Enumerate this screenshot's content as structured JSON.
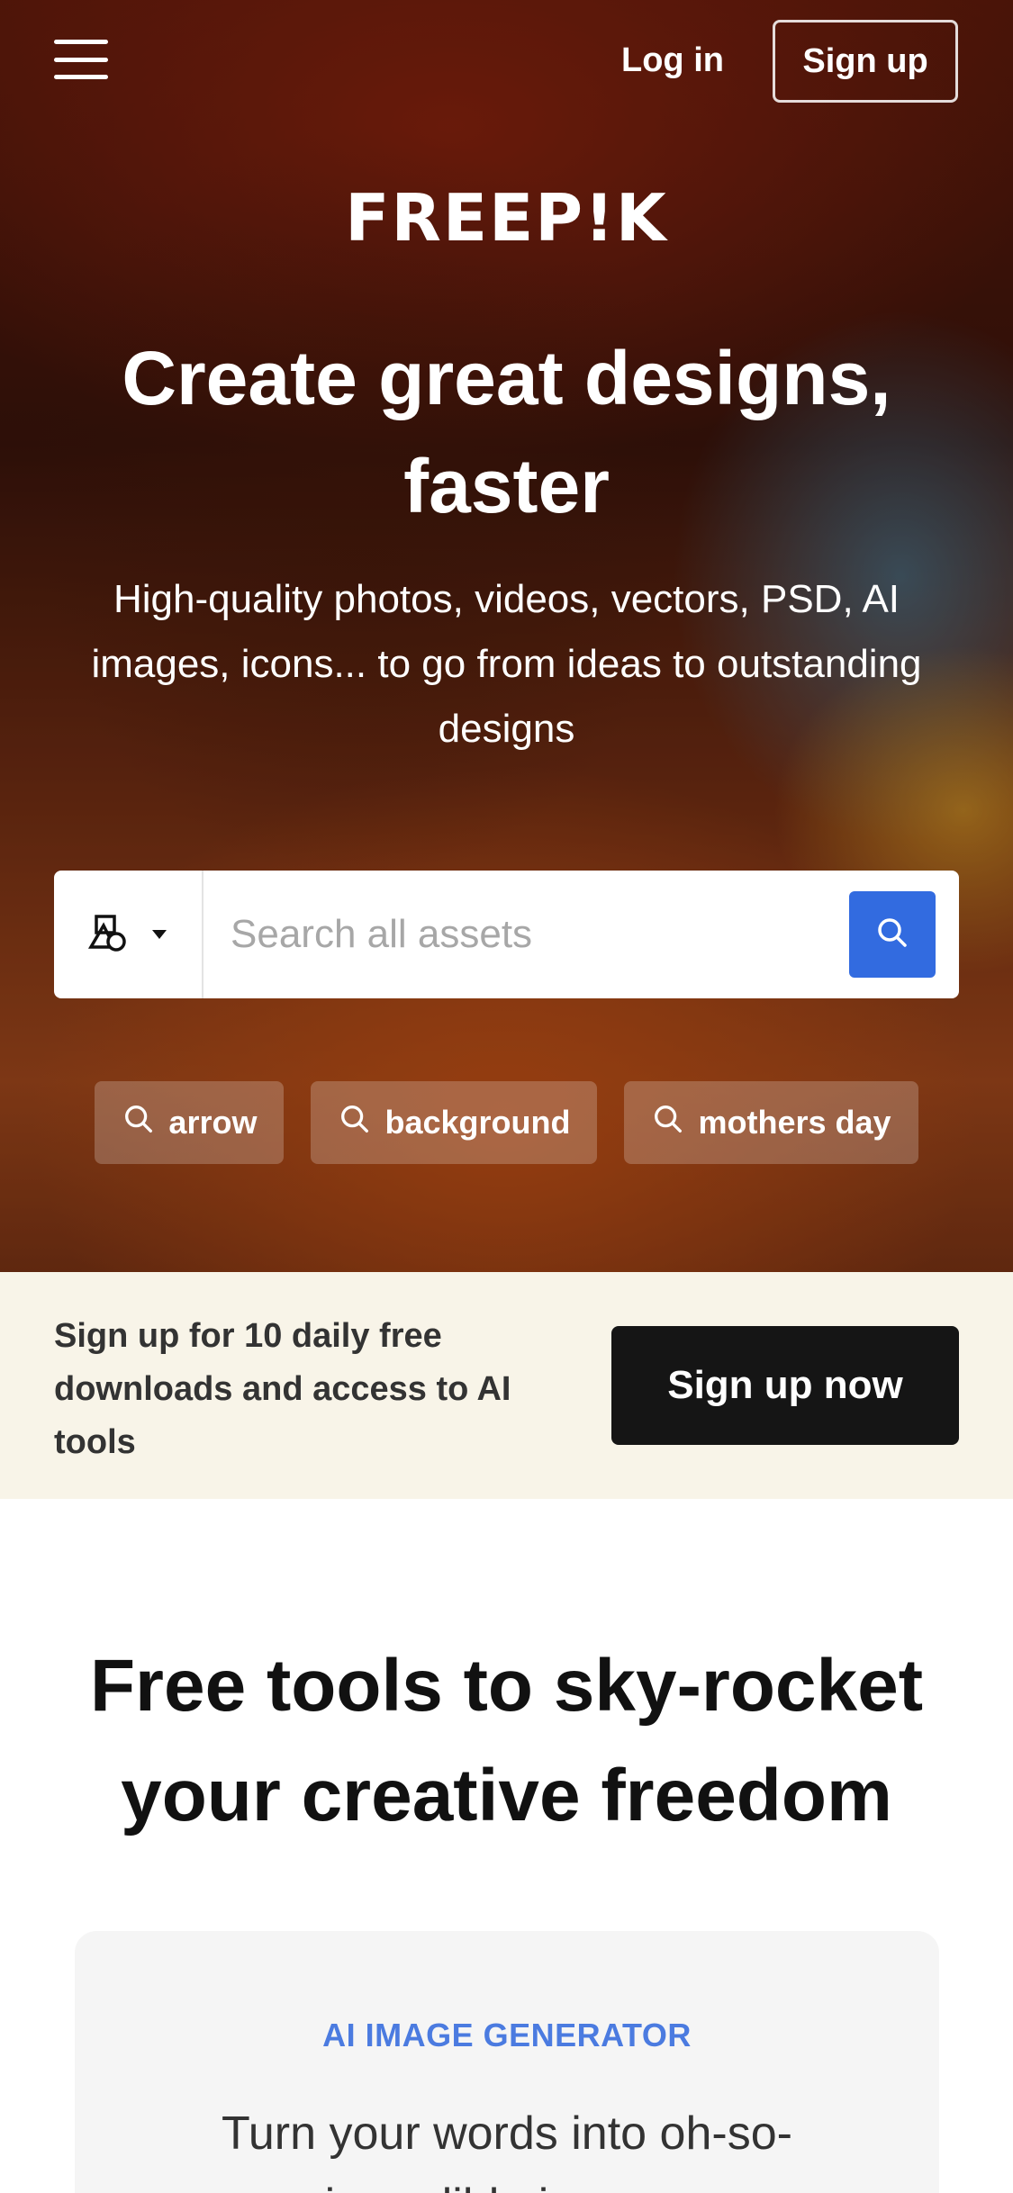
{
  "header": {
    "menu_icon": "hamburger-menu-icon",
    "login_label": "Log in",
    "signup_label": "Sign up"
  },
  "hero": {
    "logo_text": "FREEP!K",
    "title": "Create great designs, faster",
    "subtitle": "High-quality photos, videos, vectors, PSD, AI images, icons... to go from ideas to outstanding designs",
    "search": {
      "asset_type_icon": "shapes-icon",
      "placeholder": "Search all assets",
      "button_icon": "search-icon",
      "button_color": "#326be0"
    },
    "suggestions": [
      {
        "label": "arrow"
      },
      {
        "label": "background"
      },
      {
        "label": "mothers day"
      }
    ]
  },
  "banner": {
    "text": "Sign up for 10 daily free downloads and access to AI tools",
    "button_label": "Sign up now"
  },
  "tools": {
    "title": "Free tools to sky-rocket your creative freedom",
    "card": {
      "tag": "AI IMAGE GENERATOR",
      "description": "Turn your words into oh-so-incredible images"
    }
  }
}
